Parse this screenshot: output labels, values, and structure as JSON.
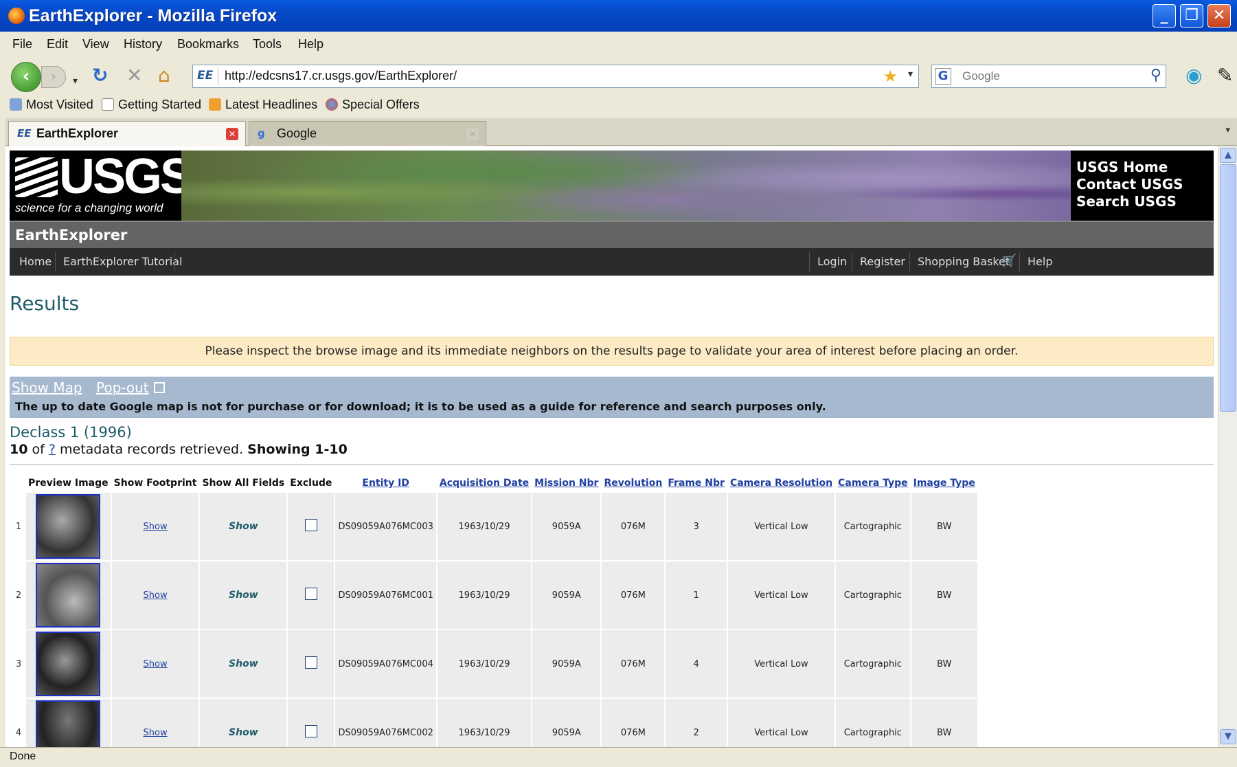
{
  "window": {
    "title": "EarthExplorer - Mozilla Firefox"
  },
  "menu": [
    "File",
    "Edit",
    "View",
    "History",
    "Bookmarks",
    "Tools",
    "Help"
  ],
  "nav": {
    "url": "http://edcsns17.cr.usgs.gov/EarthExplorer/",
    "search_placeholder": "Google",
    "url_badge": "EE"
  },
  "bookmarks": [
    "Most Visited",
    "Getting Started",
    "Latest Headlines",
    "Special Offers"
  ],
  "tabs": [
    {
      "label": "EarthExplorer",
      "favicon": "EE"
    },
    {
      "label": "Google"
    }
  ],
  "usgs": {
    "logo": "USGS",
    "tagline": "science for a changing world",
    "links": [
      "USGS Home",
      "Contact USGS",
      "Search USGS"
    ],
    "app_name": "EarthExplorer",
    "nav_left": [
      "Home",
      "EarthExplorer Tutorial"
    ],
    "nav_right": [
      "Login",
      "Register",
      "Shopping Basket",
      "Help"
    ]
  },
  "page": {
    "heading": "Results",
    "notice": "Please inspect the browse image and its immediate neighbors on the results page to validate your area of interest before placing an order.",
    "show_map": "Show Map",
    "popout": "Pop-out",
    "map_disclaimer": "The up to date Google map is not for purchase or for download; it is to be used as a guide for reference and search purposes only.",
    "dataset": "Declass 1 (1996)",
    "count": "10",
    "of": "of",
    "total": "?",
    "retrieved": "metadata records retrieved.",
    "showing": "Showing 1-10"
  },
  "table": {
    "headers": [
      "Preview Image",
      "Show Footprint",
      "Show All Fields",
      "Exclude",
      "Entity ID",
      "Acquisition Date",
      "Mission Nbr",
      "Revolution",
      "Frame Nbr",
      "Camera Resolution",
      "Camera Type",
      "Image Type"
    ],
    "show_label": "Show",
    "rows": [
      {
        "n": "1",
        "entity": "DS09059A076MC003",
        "date": "1963/10/29",
        "mission": "9059A",
        "rev": "076M",
        "frame": "3",
        "res": "Vertical Low",
        "cam": "Cartographic",
        "img": "BW"
      },
      {
        "n": "2",
        "entity": "DS09059A076MC001",
        "date": "1963/10/29",
        "mission": "9059A",
        "rev": "076M",
        "frame": "1",
        "res": "Vertical Low",
        "cam": "Cartographic",
        "img": "BW"
      },
      {
        "n": "3",
        "entity": "DS09059A076MC004",
        "date": "1963/10/29",
        "mission": "9059A",
        "rev": "076M",
        "frame": "4",
        "res": "Vertical Low",
        "cam": "Cartographic",
        "img": "BW"
      },
      {
        "n": "4",
        "entity": "DS09059A076MC002",
        "date": "1963/10/29",
        "mission": "9059A",
        "rev": "076M",
        "frame": "2",
        "res": "Vertical Low",
        "cam": "Cartographic",
        "img": "BW"
      }
    ]
  },
  "status": "Done"
}
